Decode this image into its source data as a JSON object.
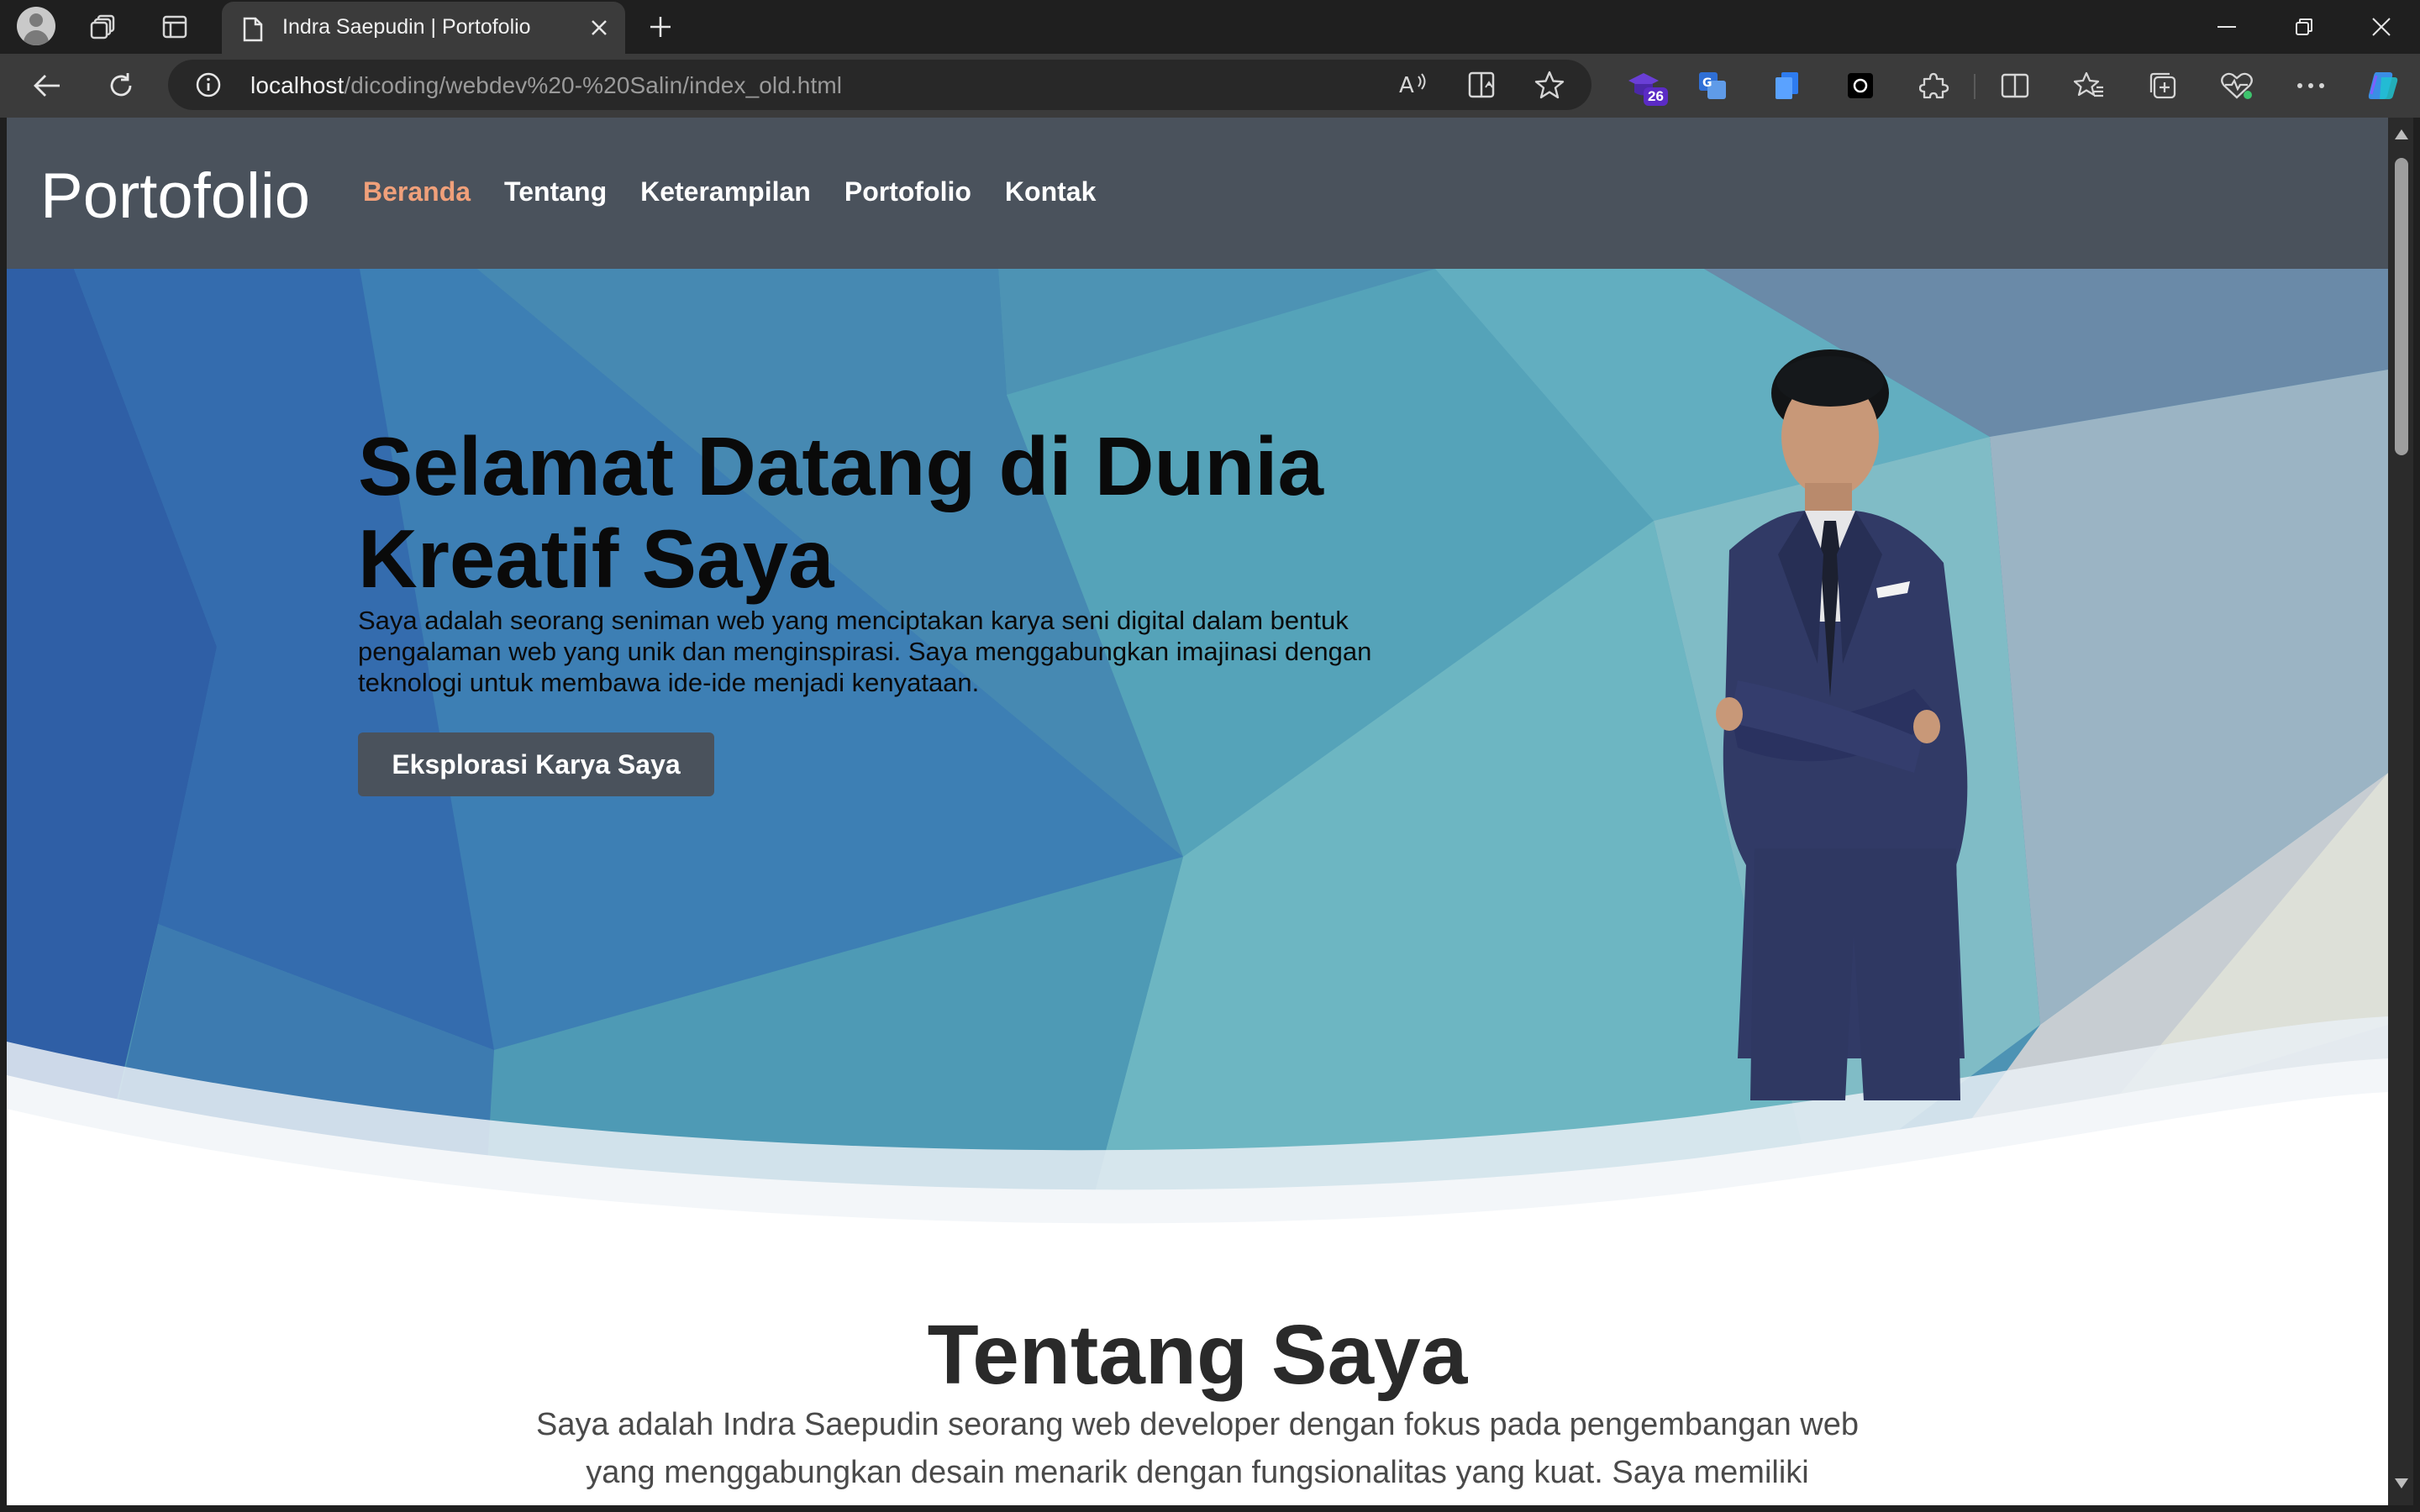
{
  "browser": {
    "tab_title": "Indra Saepudin | Portofolio",
    "url_host": "localhost",
    "url_path": "/dicoding/webdev%20-%20Salin/index_old.html",
    "extension_badge": "26"
  },
  "site": {
    "brand": "Portofolio",
    "nav": [
      {
        "label": "Beranda",
        "active": true
      },
      {
        "label": "Tentang",
        "active": false
      },
      {
        "label": "Keterampilan",
        "active": false
      },
      {
        "label": "Portofolio",
        "active": false
      },
      {
        "label": "Kontak",
        "active": false
      }
    ],
    "hero": {
      "title": "Selamat Datang di Dunia Kreatif Saya",
      "text": "Saya adalah seorang seniman web yang menciptakan karya seni digital dalam bentuk pengalaman web yang unik dan menginspirasi. Saya menggabungkan imajinasi dengan teknologi untuk membawa ide-ide menjadi kenyataan.",
      "button": "Eksplorasi Karya Saya"
    },
    "about": {
      "title": "Tentang Saya",
      "text": "Saya adalah Indra Saepudin seorang web developer dengan fokus pada pengembangan web yang menggabungkan desain menarik dengan fungsionalitas yang kuat. Saya memiliki"
    }
  },
  "colors": {
    "header_bg": "#4a525c",
    "nav_active": "#f0a07a",
    "button_bg": "#4a525c"
  },
  "icons": [
    "profile-icon",
    "workspaces-icon",
    "tab-actions-icon",
    "page-icon",
    "close-icon",
    "new-tab-icon",
    "minimize-icon",
    "restore-icon",
    "window-close-icon",
    "back-icon",
    "refresh-icon",
    "info-icon",
    "read-aloud-icon",
    "immersive-reader-icon",
    "favorite-star-icon",
    "extension-puzzle-icon",
    "split-screen-icon",
    "favorites-icon",
    "collections-icon",
    "browser-essentials-icon",
    "more-icon",
    "copilot-icon"
  ]
}
